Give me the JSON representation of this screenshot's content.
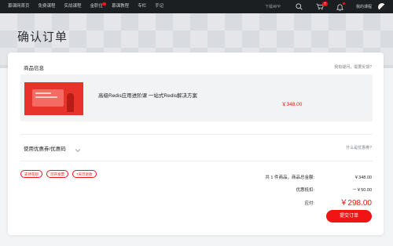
{
  "nav": {
    "items": [
      {
        "label": "慕课网首页"
      },
      {
        "label": "免费课程"
      },
      {
        "label": "实战课程"
      },
      {
        "label": "金职位",
        "dot": true
      },
      {
        "label": "慕课教程"
      },
      {
        "label": "专栏"
      },
      {
        "label": "手记"
      }
    ],
    "app_label": "下载APP",
    "cart_count": "7",
    "user_label": "我的课程"
  },
  "page": {
    "title": "确认订单"
  },
  "goods": {
    "title": "商品信息",
    "help": "我有疑问，需要反馈?",
    "course_name": "高级Redis应用进阶课 一站式Redis解决方案",
    "price": "￥348.00"
  },
  "coupon": {
    "label": "使用优惠券/优惠码",
    "help": "什么是优惠券?"
  },
  "tags": [
    "支持花呗",
    "可开发票",
    "7天可退款"
  ],
  "summary": {
    "count_label": "共 1 件商品，商品总金额:",
    "count_value": "￥348.00",
    "discount_label": "优惠抵扣:",
    "discount_value": "－￥50.00",
    "pay_label": "应付:",
    "pay_value": "￥298.00"
  },
  "submit_label": "提交订单",
  "colors": {
    "accent": "#f01414",
    "nav_bg": "#1c1f21"
  }
}
